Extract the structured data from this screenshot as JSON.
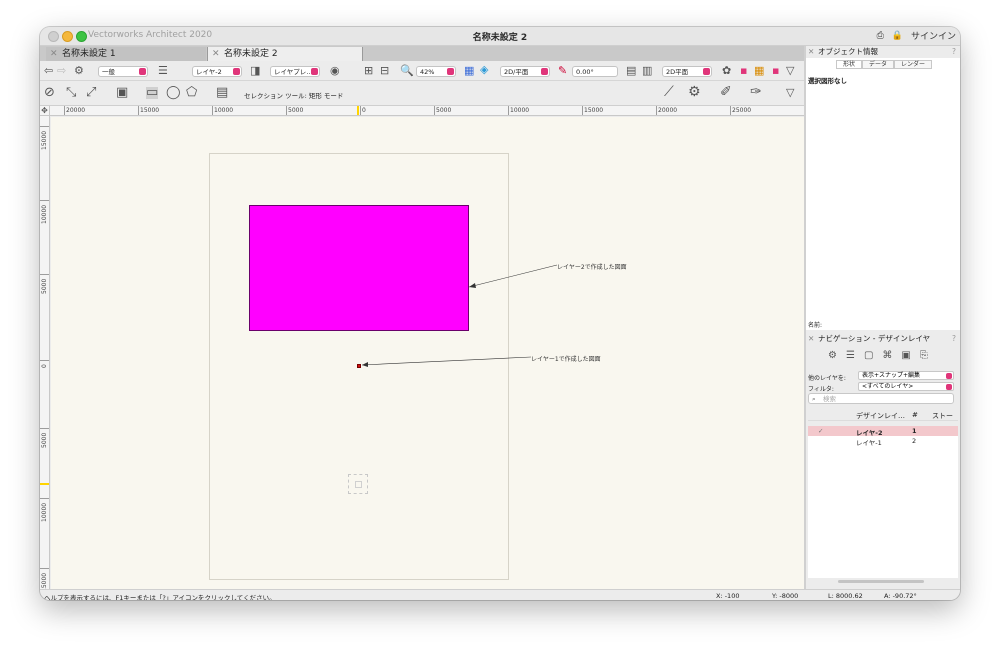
{
  "window": {
    "app_name": "Vectorworks Architect 2020",
    "doc_title": "名称未設定 2",
    "signin": "サインイン"
  },
  "tabs": [
    {
      "label": "名称未設定 1",
      "active": false
    },
    {
      "label": "名称未設定 2",
      "active": true
    }
  ],
  "toolbar1": {
    "class_select": "一般",
    "layer_select": "レイヤ-2",
    "layer_plane_select": "レイヤプレ…",
    "zoom_value": "42%",
    "view_select": "2D/平面",
    "angle_value": "0.00°",
    "render_select": "2D平面"
  },
  "toolbar2": {
    "mode_label": "セレクション ツール: 矩形 モード"
  },
  "ruler": {
    "h_ticks": [
      "20000",
      "15000",
      "10000",
      "5000",
      "0",
      "5000",
      "10000",
      "15000",
      "20000",
      "25000"
    ],
    "v_ticks": [
      "15000",
      "10000",
      "5000",
      "0",
      "5000",
      "10000",
      "15000"
    ]
  },
  "drawing": {
    "annotation_layer2": "レイヤー2で作成した図面",
    "annotation_layer1": "レイヤー1で作成した図面",
    "rect_color": "#ff00ff"
  },
  "status": {
    "help": "ヘルプを表示するには、F1キーまたは「?」アイコンをクリックしてください。",
    "x": "X: -100",
    "y": "Y: -8000",
    "l": "L: 8000.62",
    "a": "A: -90.72°"
  },
  "object_info": {
    "title": "オブジェクト情報",
    "tabs": [
      "形状",
      "データ",
      "レンダー"
    ],
    "no_selection": "選択図形なし",
    "name_label": "名前:"
  },
  "navigation": {
    "title": "ナビゲーション - デザインレイヤ",
    "other_layers_label": "他のレイヤを:",
    "other_layers_value": "表示+スナップ+編集",
    "filter_label": "フィルタ:",
    "filter_value": "<すべてのレイヤ>",
    "search_placeholder": "検索",
    "columns": [
      "デザインレイ…",
      "#",
      "ストー"
    ],
    "rows": [
      {
        "check": "✓",
        "name": "レイヤ-2",
        "num": "1",
        "active": true
      },
      {
        "check": "",
        "name": "レイヤ-1",
        "num": "2",
        "active": false
      }
    ]
  }
}
